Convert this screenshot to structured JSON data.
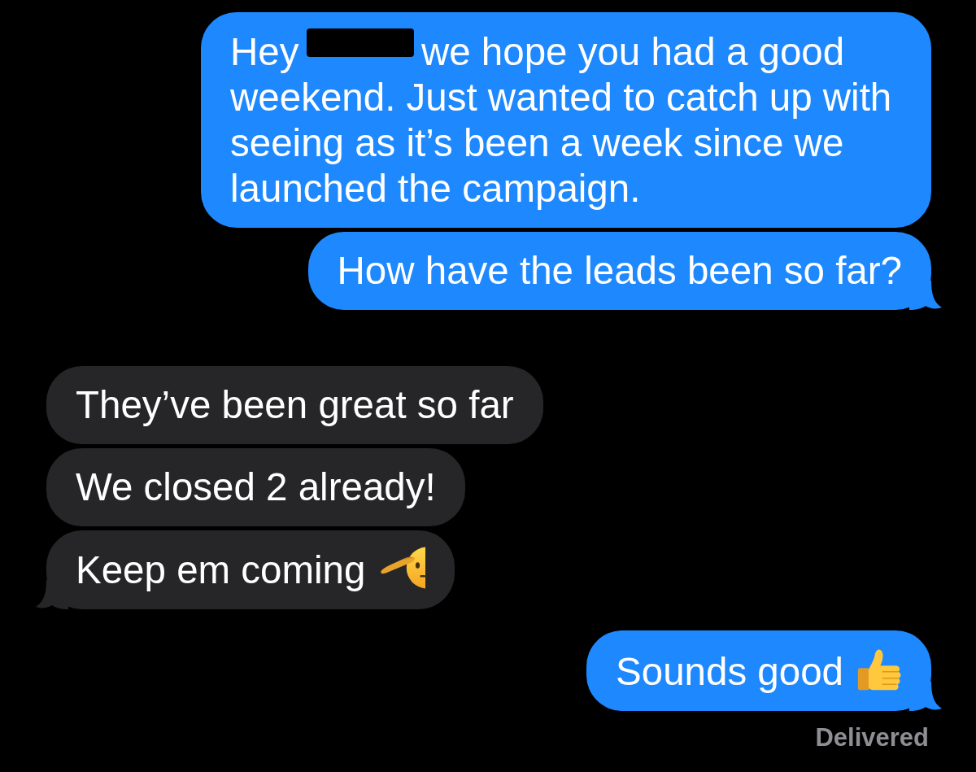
{
  "messages": [
    {
      "kind": "sent",
      "tail": false,
      "segments": [
        {
          "kind": "text",
          "text": "Hey"
        },
        {
          "kind": "redaction"
        },
        {
          "kind": "text",
          "text": "we hope you had a good weekend. Just wanted to catch up with seeing as it’s been a week since we launched the campaign."
        }
      ]
    },
    {
      "kind": "sent",
      "tail": true,
      "segments": [
        {
          "kind": "text",
          "text": "How have the leads been so far?"
        }
      ]
    },
    {
      "kind": "received",
      "tail": false,
      "segments": [
        {
          "kind": "text",
          "text": "They’ve been great so far"
        }
      ]
    },
    {
      "kind": "received",
      "tail": false,
      "segments": [
        {
          "kind": "text",
          "text": "We closed 2 already!"
        }
      ]
    },
    {
      "kind": "received",
      "tail": true,
      "segments": [
        {
          "kind": "text",
          "text": "Keep em coming"
        },
        {
          "kind": "salute"
        }
      ]
    },
    {
      "kind": "sent",
      "tail": true,
      "segments": [
        {
          "kind": "text",
          "text": "Sounds good"
        },
        {
          "kind": "thumbs_up"
        }
      ]
    }
  ],
  "status": {
    "text": "Delivered"
  }
}
